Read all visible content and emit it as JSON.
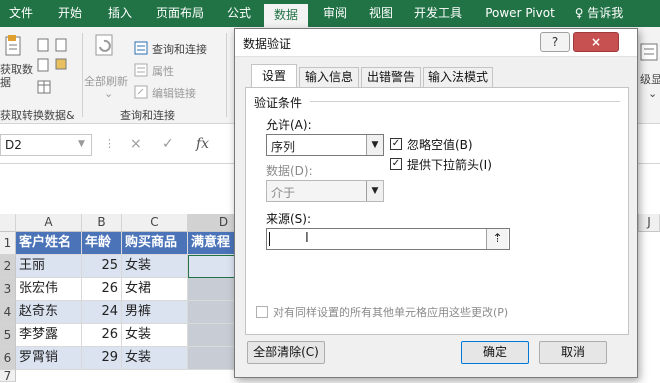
{
  "ribbon": {
    "tabs": [
      "文件",
      "开始",
      "插入",
      "页面布局",
      "公式",
      "数据",
      "审阅",
      "视图",
      "开发工具",
      "Power Pivot",
      "♀ 告诉我"
    ],
    "groups": {
      "get_data": "获取数\n据",
      "get_transform": "获取转换数据&",
      "refresh_all": "全部刷新",
      "connections": "查询和连接",
      "properties": "属性",
      "edit_links": "编辑链接",
      "connections_group": "查询和连接",
      "partial_right": "级显示"
    }
  },
  "formula_bar": {
    "name_box": "D2",
    "cancel": "×",
    "enter": "✓",
    "fx": "fx"
  },
  "sheet": {
    "columns": [
      "A",
      "B",
      "C",
      "D"
    ],
    "far_col": "J",
    "rows": [
      "1",
      "2",
      "3",
      "4",
      "5",
      "6",
      "7"
    ],
    "header": [
      "客户姓名",
      "年龄",
      "购买商品",
      "满意程"
    ],
    "data": [
      {
        "name": "王丽",
        "age": "25",
        "item": "女装"
      },
      {
        "name": "张宏伟",
        "age": "26",
        "item": "女裙"
      },
      {
        "name": "赵奇东",
        "age": "24",
        "item": "男裤"
      },
      {
        "name": "李梦露",
        "age": "26",
        "item": "女装"
      },
      {
        "name": "罗霄销",
        "age": "29",
        "item": "女装"
      }
    ]
  },
  "dialog": {
    "title": "数据验证",
    "help": "?",
    "close": "×",
    "tabs": [
      "设置",
      "输入信息",
      "出错警告",
      "输入法模式"
    ],
    "section": "验证条件",
    "allow_label": "允许(A):",
    "allow_value": "序列",
    "data_label": "数据(D):",
    "data_value": "介于",
    "ignore_blank": "忽略空值(B)",
    "dropdown_arrow": "提供下拉箭头(I)",
    "source_label": "来源(S):",
    "source_value": "",
    "apply_all": "对有同样设置的所有其他单元格应用这些更改(P)",
    "clear_all": "全部清除(C)",
    "ok": "确定",
    "cancel": "取消"
  },
  "colors": {
    "ribbon_green": "#217346",
    "table_header": "#4a73b8",
    "band": "#dbe3f1"
  }
}
